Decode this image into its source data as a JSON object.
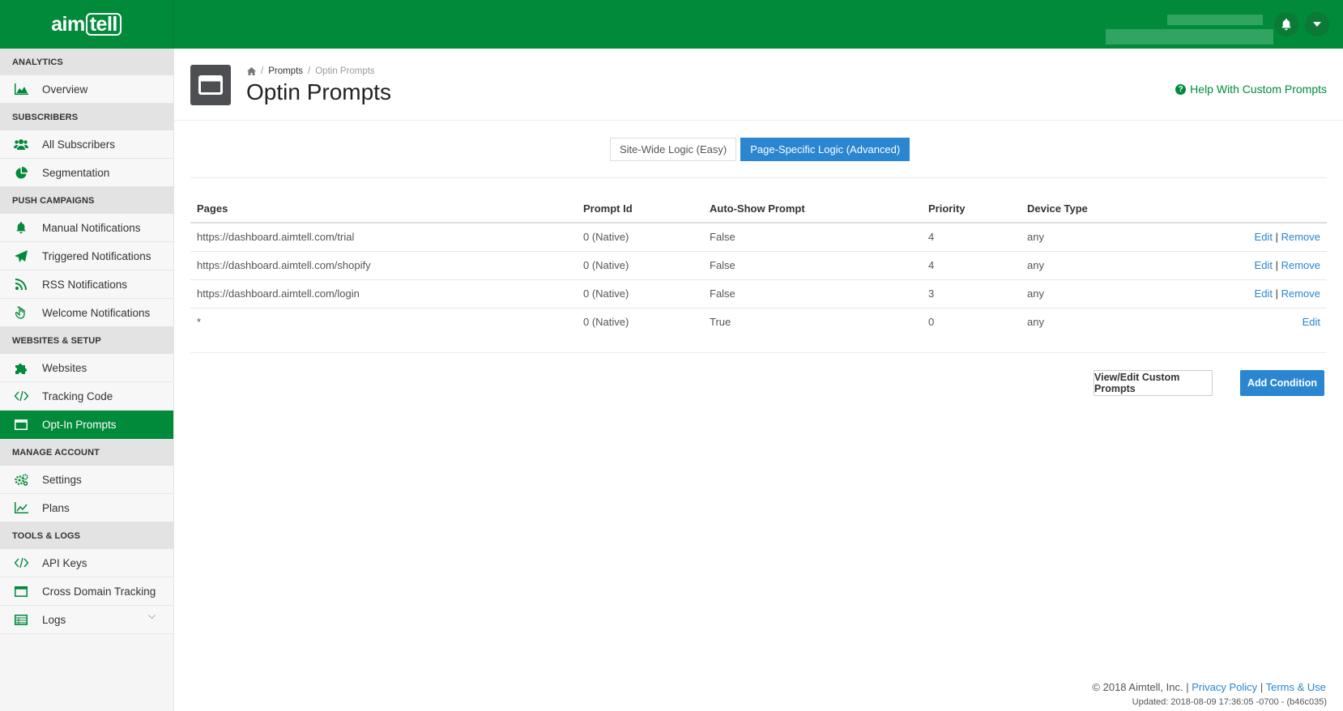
{
  "brand": {
    "logo_left": "aim",
    "logo_right": "tell",
    "color": "#008a3a"
  },
  "sidebar": {
    "sections": [
      {
        "title": "ANALYTICS",
        "items": [
          {
            "label": "Overview",
            "icon": "area-chart-icon"
          }
        ]
      },
      {
        "title": "SUBSCRIBERS",
        "items": [
          {
            "label": "All Subscribers",
            "icon": "users-icon"
          },
          {
            "label": "Segmentation",
            "icon": "pie-chart-icon"
          }
        ]
      },
      {
        "title": "PUSH CAMPAIGNS",
        "items": [
          {
            "label": "Manual Notifications",
            "icon": "bell-icon"
          },
          {
            "label": "Triggered Notifications",
            "icon": "paper-plane-icon"
          },
          {
            "label": "RSS Notifications",
            "icon": "rss-icon"
          },
          {
            "label": "Welcome Notifications",
            "icon": "hand-wave-icon"
          }
        ]
      },
      {
        "title": "WEBSITES & SETUP",
        "items": [
          {
            "label": "Websites",
            "icon": "puzzle-icon"
          },
          {
            "label": "Tracking Code",
            "icon": "code-icon"
          },
          {
            "label": "Opt-In Prompts",
            "icon": "window-icon",
            "active": true
          }
        ]
      },
      {
        "title": "MANAGE ACCOUNT",
        "items": [
          {
            "label": "Settings",
            "icon": "gears-icon"
          },
          {
            "label": "Plans",
            "icon": "line-chart-icon"
          }
        ]
      },
      {
        "title": "TOOLS & LOGS",
        "items": [
          {
            "label": "API Keys",
            "icon": "code-icon"
          },
          {
            "label": "Cross Domain Tracking",
            "icon": "window-icon"
          },
          {
            "label": "Logs",
            "icon": "table-icon"
          }
        ]
      }
    ]
  },
  "header": {
    "breadcrumb": {
      "home_icon": "home-icon",
      "link": "Prompts",
      "current": "Optin Prompts"
    },
    "title": "Optin Prompts",
    "help": "Help With Custom Prompts"
  },
  "toggle": {
    "easy": "Site-Wide Logic (Easy)",
    "advanced": "Page-Specific Logic (Advanced)"
  },
  "table": {
    "headers": [
      "Pages",
      "Prompt Id",
      "Auto-Show Prompt",
      "Priority",
      "Device Type"
    ],
    "rows": [
      {
        "page": "https://dashboard.aimtell.com/trial",
        "prompt_id": "0 (Native)",
        "auto_show": "False",
        "priority": "4",
        "device": "any",
        "edit": "Edit",
        "sep": "|",
        "remove": "Remove"
      },
      {
        "page": "https://dashboard.aimtell.com/shopify",
        "prompt_id": "0 (Native)",
        "auto_show": "False",
        "priority": "4",
        "device": "any",
        "edit": "Edit",
        "sep": "|",
        "remove": "Remove"
      },
      {
        "page": "https://dashboard.aimtell.com/login",
        "prompt_id": "0 (Native)",
        "auto_show": "False",
        "priority": "3",
        "device": "any",
        "edit": "Edit",
        "sep": "|",
        "remove": "Remove"
      },
      {
        "page": "*",
        "prompt_id": "0 (Native)",
        "auto_show": "True",
        "priority": "0",
        "device": "any",
        "edit": "Edit"
      }
    ]
  },
  "buttons": {
    "view_edit": "View/Edit Custom Prompts",
    "add": "Add Condition"
  },
  "footer": {
    "copyright": "© 2018 Aimtell, Inc.",
    "sep": "|",
    "privacy": "Privacy Policy",
    "terms": "Terms & Use",
    "updated": "Updated: 2018-08-09 17:36:05 -0700 - (b46c035)"
  }
}
